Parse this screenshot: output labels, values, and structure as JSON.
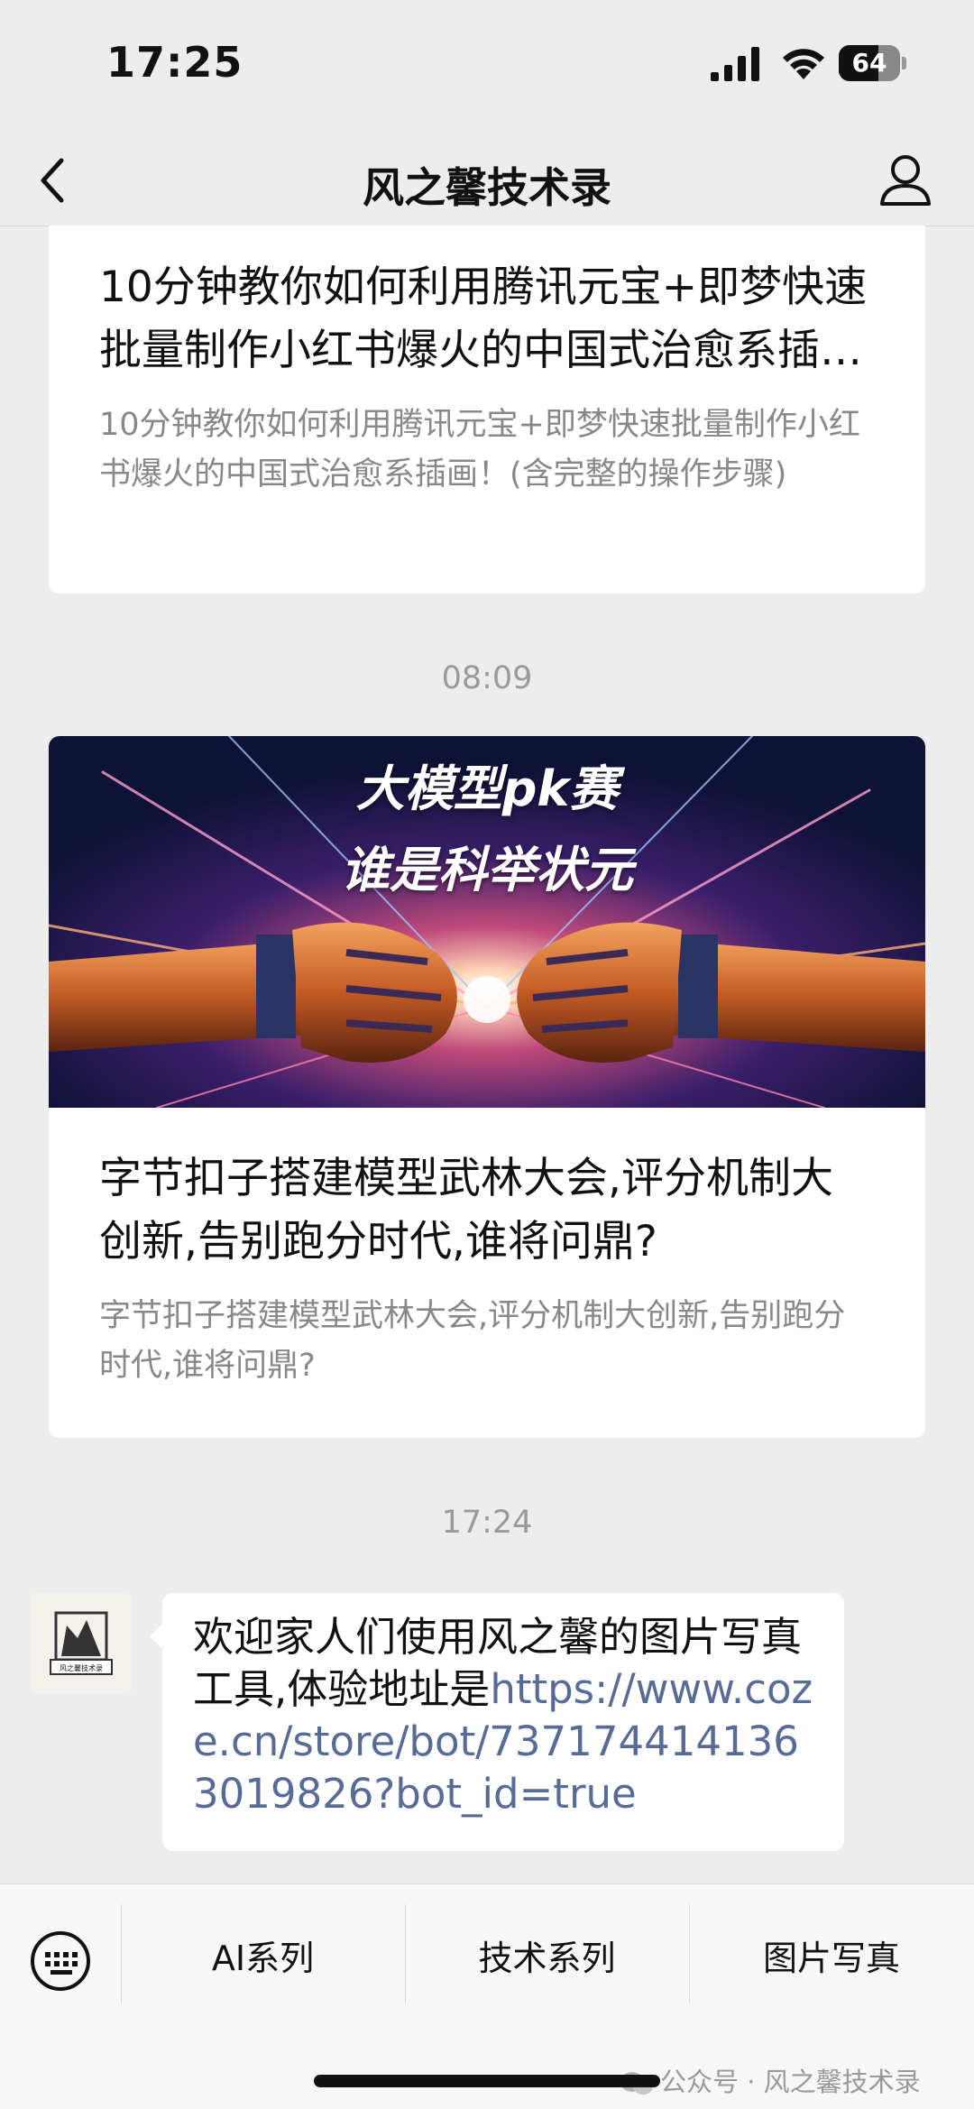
{
  "status_bar": {
    "time": "17:25",
    "battery": "64",
    "battery_level": 0.64
  },
  "nav": {
    "title": "风之馨技术录"
  },
  "articles": [
    {
      "title": "10分钟教你如何利用腾讯元宝+即梦快速批量制作小红书爆火的中国式治愈系插画！(含完整的操作步骤)",
      "description": "10分钟教你如何利用腾讯元宝+即梦快速批量制作小红书爆火的中国式治愈系插画！(含完整的操作步骤)"
    },
    {
      "timestamp": "08:09",
      "cover_line1": "大模型pk赛",
      "cover_line2": "谁是科举状元",
      "title": "字节扣子搭建模型武林大会,评分机制大创新,告别跑分时代,谁将问鼎?",
      "description": "字节扣子搭建模型武林大会,评分机制大创新,告别跑分时代,谁将问鼎?"
    }
  ],
  "message": {
    "timestamp": "17:24",
    "text": "欢迎家人们使用风之馨的图片写真工具,体验地址是",
    "link": "https://www.coze.cn/store/bot/7371744141363019826?bot_id=true",
    "avatar_label": "风之馨技术录"
  },
  "menu": {
    "items": [
      "AI系列",
      "技术系列",
      "图片写真"
    ],
    "watermark": "公众号 · 风之馨技术录"
  },
  "colors": {
    "link": "#576b95",
    "background": "#ededed"
  }
}
